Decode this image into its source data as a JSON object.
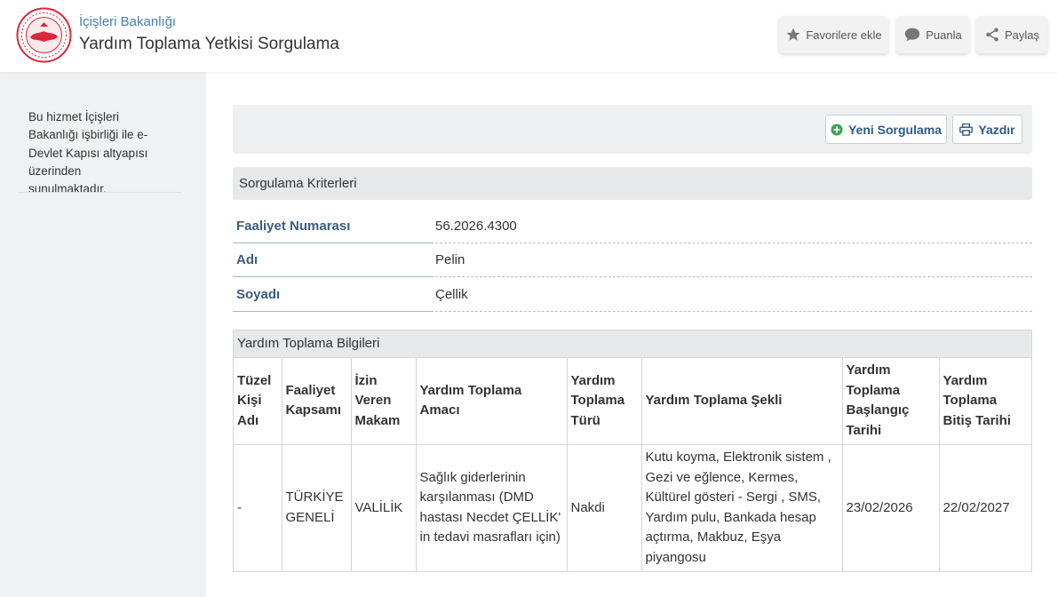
{
  "header": {
    "ministry": "İçişleri Bakanlığı",
    "service_title": "Yardım Toplama Yetkisi Sorgulama",
    "buttons": {
      "favorite": "Favorilere ekle",
      "rate": "Puanla",
      "share": "Paylaş"
    }
  },
  "sidebar": {
    "text": "Bu hizmet İçişleri Bakanlığı işbirliği ile e-Devlet Kapısı altyapısı üzerinden sunulmaktadır."
  },
  "toolbar": {
    "new_query": "Yeni Sorgulama",
    "print": "Yazdır"
  },
  "criteria": {
    "title": "Sorgulama Kriterleri",
    "rows": [
      {
        "label": "Faaliyet Numarası",
        "value": "56.2026.4300"
      },
      {
        "label": "Adı",
        "value": "Pelin"
      },
      {
        "label": "Soyadı",
        "value": "Çellik"
      }
    ]
  },
  "results": {
    "caption": "Yardım Toplama Bilgileri",
    "columns": [
      "Tüzel Kişi Adı",
      "Faaliyet Kapsamı",
      "İzin Veren Makam",
      "Yardım Toplama Amacı",
      "Yardım Toplama Türü",
      "Yardım Toplama Şekli",
      "Yardım Toplama Başlangıç Tarihi",
      "Yardım Toplama Bitiş Tarihi"
    ],
    "rows": [
      [
        "-",
        "TÜRKİYE GENELİ",
        "VALİLİK",
        "Sağlık giderlerinin karşılanması (DMD hastası Necdet ÇELLİK' in tedavi masrafları için)",
        "Nakdi",
        "Kutu koyma, Elektronik sistem , Gezi ve eğlence, Kermes, Kültürel gösteri - Sergi , SMS, Yardım pulu, Bankada hesap açtırma, Makbuz, Eşya piyangosu",
        "23/02/2026",
        "22/02/2027"
      ]
    ]
  },
  "colors": {
    "accent_link": "#4a7fb0",
    "label_blue": "#3a5d80",
    "button_text": "#2c5c8a",
    "new_icon_green": "#3aa655",
    "logo_red": "#d9283c"
  }
}
